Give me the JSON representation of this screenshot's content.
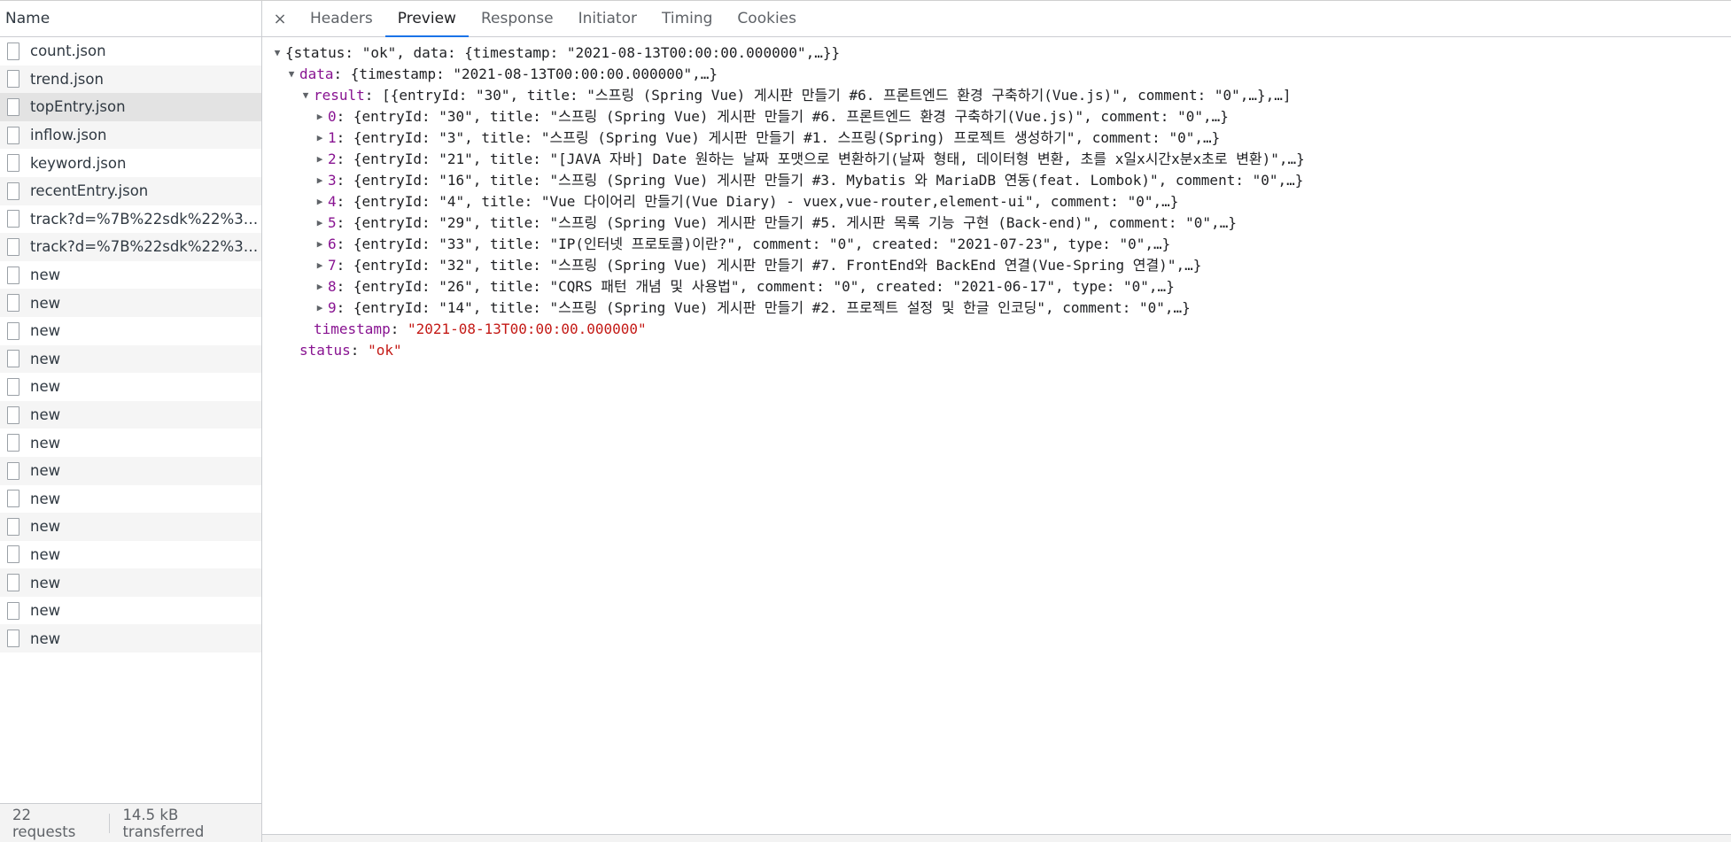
{
  "left_panel": {
    "header": "Name",
    "requests": [
      {
        "name": "count.json"
      },
      {
        "name": "trend.json"
      },
      {
        "name": "topEntry.json"
      },
      {
        "name": "inflow.json"
      },
      {
        "name": "keyword.json"
      },
      {
        "name": "recentEntry.json"
      },
      {
        "name": "track?d=%7B%22sdk%22%3A..."
      },
      {
        "name": "track?d=%7B%22sdk%22%3A..."
      },
      {
        "name": "new"
      },
      {
        "name": "new"
      },
      {
        "name": "new"
      },
      {
        "name": "new"
      },
      {
        "name": "new"
      },
      {
        "name": "new"
      },
      {
        "name": "new"
      },
      {
        "name": "new"
      },
      {
        "name": "new"
      },
      {
        "name": "new"
      },
      {
        "name": "new"
      },
      {
        "name": "new"
      },
      {
        "name": "new"
      },
      {
        "name": "new"
      }
    ],
    "selected_index": 2,
    "status": {
      "requests": "22 requests",
      "transferred": "14.5 kB transferred"
    }
  },
  "tabs": {
    "close_label": "×",
    "items": [
      {
        "label": "Headers"
      },
      {
        "label": "Preview"
      },
      {
        "label": "Response"
      },
      {
        "label": "Initiator"
      },
      {
        "label": "Timing"
      },
      {
        "label": "Cookies"
      }
    ],
    "active_index": 1
  },
  "preview": {
    "root_summary": "{status: \"ok\", data: {timestamp: \"2021-08-13T00:00:00.000000\",…}}",
    "data_key": "data",
    "data_summary": "{timestamp: \"2021-08-13T00:00:00.000000\",…}",
    "result_key": "result",
    "result_summary": "[{entryId: \"30\", title: \"스프링 (Spring Vue) 게시판 만들기 #6. 프론트엔드 환경 구축하기(Vue.js)\", comment: \"0\",…},…]",
    "items": [
      {
        "idx": "0",
        "text": "{entryId: \"30\", title: \"스프링 (Spring Vue) 게시판 만들기 #6. 프론트엔드 환경 구축하기(Vue.js)\", comment: \"0\",…}"
      },
      {
        "idx": "1",
        "text": "{entryId: \"3\", title: \"스프링 (Spring Vue) 게시판 만들기 #1. 스프링(Spring) 프로젝트 생성하기\", comment: \"0\",…}"
      },
      {
        "idx": "2",
        "text": "{entryId: \"21\", title: \"[JAVA 자바] Date 원하는 날짜 포맷으로 변환하기(날짜 형태, 데이터형 변환, 초를 x일x시간x분x초로 변환)\",…}"
      },
      {
        "idx": "3",
        "text": "{entryId: \"16\", title: \"스프링 (Spring Vue) 게시판 만들기 #3. Mybatis 와 MariaDB 연동(feat. Lombok)\", comment: \"0\",…}"
      },
      {
        "idx": "4",
        "text": "{entryId: \"4\", title: \"Vue 다이어리 만들기(Vue Diary) - vuex,vue-router,element-ui\", comment: \"0\",…}"
      },
      {
        "idx": "5",
        "text": "{entryId: \"29\", title: \"스프링 (Spring Vue) 게시판 만들기 #5. 게시판 목록 기능 구현 (Back-end)\", comment: \"0\",…}"
      },
      {
        "idx": "6",
        "text": "{entryId: \"33\", title: \"IP(인터넷 프로토콜)이란?\", comment: \"0\", created: \"2021-07-23\", type: \"0\",…}"
      },
      {
        "idx": "7",
        "text": "{entryId: \"32\", title: \"스프링 (Spring Vue) 게시판 만들기 #7. FrontEnd와 BackEnd 연결(Vue-Spring 연결)\",…}"
      },
      {
        "idx": "8",
        "text": "{entryId: \"26\", title: \"CQRS 패턴 개념 및 사용법\", comment: \"0\", created: \"2021-06-17\", type: \"0\",…}"
      },
      {
        "idx": "9",
        "text": "{entryId: \"14\", title: \"스프링 (Spring Vue) 게시판 만들기 #2. 프로젝트 설정 및 한글 인코딩\", comment: \"0\",…}"
      }
    ],
    "timestamp_key": "timestamp",
    "timestamp_value": "\"2021-08-13T00:00:00.000000\"",
    "status_key": "status",
    "status_value": "\"ok\""
  },
  "colors": {
    "accent": "#1a73e8",
    "key": "#881391",
    "string": "#c41a16"
  }
}
